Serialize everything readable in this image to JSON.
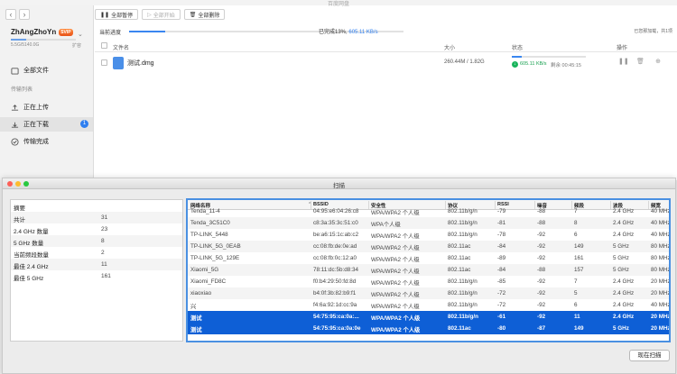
{
  "win1": {
    "title": "百度网盘",
    "nav": {
      "back": "‹",
      "forward": "›"
    },
    "user": {
      "name": "ZhAngZhoYn",
      "badge": "SVIP",
      "quota": "5.5G/5140.0G",
      "expand": "扩容",
      "quota_fraction": 0.001
    },
    "sidebar": {
      "all_files": "全部文件",
      "section": "传输列表",
      "uploading": "正在上传",
      "downloading": "正在下载",
      "downloading_count": "1",
      "done": "传输完成"
    },
    "toolbar": {
      "pause_all": "全部暂停",
      "start_all": "全部开始",
      "delete_all": "全部删除"
    },
    "progress": {
      "label": "当前进度",
      "percent": 13,
      "text_prefix": "已完成13%,",
      "speed": "605.11 KB/s",
      "right_text": "已您那加载，共1项"
    },
    "columns": {
      "name": "文件名",
      "size": "大小",
      "status": "状态",
      "ops": "操作"
    },
    "file": {
      "name": "测试.dmg",
      "size": "260.44M / 1.82G",
      "speed": "605.11 KB/s",
      "remain": "剩余 00:45:15",
      "progress": 0.14
    }
  },
  "scan": {
    "title": "扫描",
    "summary": [
      {
        "k": "摘要",
        "v": ""
      },
      {
        "k": "共计",
        "v": "31"
      },
      {
        "k": "2.4 GHz 数量",
        "v": "23"
      },
      {
        "k": "5 GHz 数量",
        "v": "8"
      },
      {
        "k": "当前频段数量",
        "v": "2"
      },
      {
        "k": "最佳 2.4 GHz",
        "v": "11"
      },
      {
        "k": "最佳 5 GHz",
        "v": "161"
      }
    ],
    "headers": [
      "网络名称",
      "BSSID",
      "安全性",
      "协议",
      "RSSI",
      "噪音",
      "频段",
      "波段",
      "频宽"
    ],
    "rows": [
      [
        "Tenda_11-4",
        "04:95:e6:04:26:c8",
        "WPA/WPA2 个人级",
        "802.11b/g/n",
        "-79",
        "-88",
        "7",
        "2.4 GHz",
        "40 MHz"
      ],
      [
        "Tenda_3C51C0",
        "c8:3a:35:3c:51:c0",
        "WPA个人级",
        "802.11b/g/n",
        "-81",
        "-88",
        "8",
        "2.4 GHz",
        "40 MHz"
      ],
      [
        "TP-LINK_5448",
        "be:a6:15:1c:ab:c2",
        "WPA/WPA2 个人级",
        "802.11b/g/n",
        "-78",
        "-92",
        "6",
        "2.4 GHz",
        "40 MHz"
      ],
      [
        "TP-LINK_5G_0EAB",
        "cc:08:fb:de:0e:ad",
        "WPA/WPA2 个人级",
        "802.11ac",
        "-84",
        "-92",
        "149",
        "5 GHz",
        "80 MHz"
      ],
      [
        "TP-LINK_5G_129E",
        "cc:08:fb:0c:12:a0",
        "WPA/WPA2 个人级",
        "802.11ac",
        "-89",
        "-92",
        "161",
        "5 GHz",
        "80 MHz"
      ],
      [
        "Xiaomi_5G",
        "78:11:dc:5b:d8:34",
        "WPA/WPA2 个人级",
        "802.11ac",
        "-84",
        "-88",
        "157",
        "5 GHz",
        "80 MHz"
      ],
      [
        "Xiaomi_FD8C",
        "f0:b4:29:50:fd:8d",
        "WPA/WPA2 个人级",
        "802.11b/g/n",
        "-85",
        "-92",
        "7",
        "2.4 GHz",
        "20 MHz"
      ],
      [
        "xiaoxiao",
        "b4:0f:3b:82:b9:f1",
        "WPA/WPA2 个人级",
        "802.11b/g/n",
        "-72",
        "-92",
        "5",
        "2.4 GHz",
        "20 MHz"
      ],
      [
        "兴",
        "f4:6a:92:1d:cc:9a",
        "WPA/WPA2 个人级",
        "802.11b/g/n",
        "-72",
        "-92",
        "6",
        "2.4 GHz",
        "40 MHz"
      ],
      [
        "测试",
        "54:75:95:ca:0a:...",
        "WPA/WPA2 个人级",
        "802.11b/g/n",
        "-61",
        "-92",
        "11",
        "2.4 GHz",
        "20 MHz"
      ],
      [
        "测试",
        "54:75:95:ca:0a:0e",
        "WPA/WPA2 个人级",
        "802.11ac",
        "-80",
        "-87",
        "149",
        "5 GHz",
        "20 MHz"
      ]
    ],
    "rescan": "现在扫描",
    "colors": {
      "selection": "#0e5fd6",
      "focus": "#4a90e2"
    }
  }
}
